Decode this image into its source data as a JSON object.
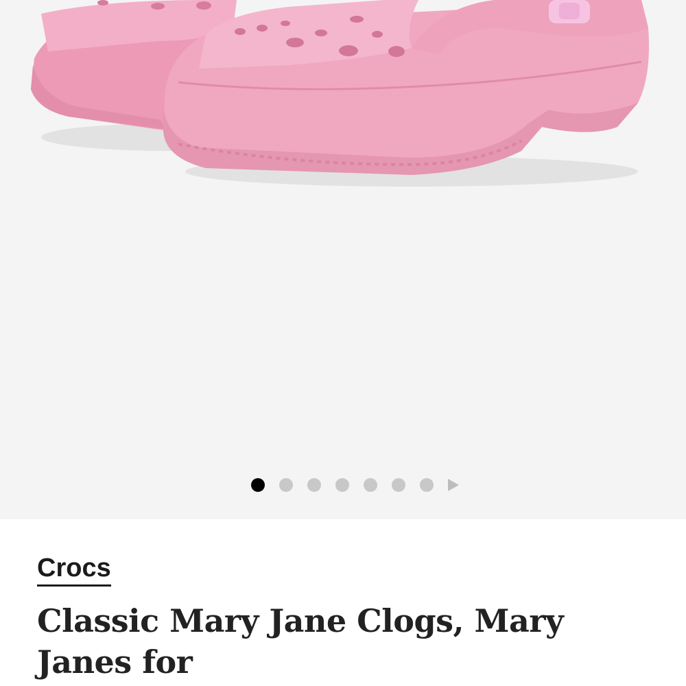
{
  "gallery": {
    "image_alt": "Pink Crocs Classic Mary Jane Clogs",
    "total_images": 7,
    "active_index": 0,
    "colors": {
      "background": "#f4f4f4",
      "shoe": "#f0a8c0",
      "dot_active": "#000000",
      "dot_inactive": "#c8c8c8"
    },
    "next_icon": "play-triangle-icon"
  },
  "product": {
    "brand": "Crocs",
    "title": "Classic Mary Jane Clogs, Mary Janes for"
  }
}
